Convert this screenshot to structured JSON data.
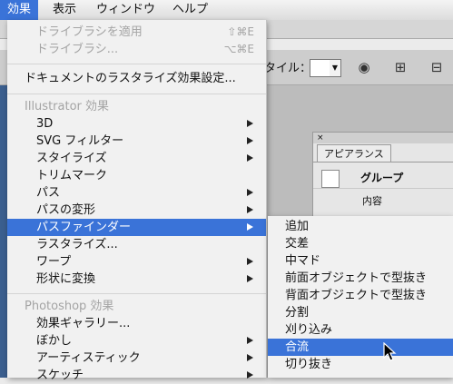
{
  "menubar": {
    "items": [
      {
        "label": "効果",
        "active": true
      },
      {
        "label": "表示",
        "active": false
      },
      {
        "label": "ウィンドウ",
        "active": false
      },
      {
        "label": "ヘルプ",
        "active": false
      }
    ]
  },
  "control_bar": {
    "style_label": "タイル：",
    "icons": [
      "recolor-icon",
      "align-grid-icon",
      "transform-icon"
    ]
  },
  "appearance_panel": {
    "close_glyph": "×",
    "tab": "アピアランス",
    "group_label": "グループ",
    "content_label": "内容"
  },
  "effect_menu": {
    "items": [
      {
        "label": "ドライブラシを適用",
        "shortcut": "⇧⌘E",
        "disabled": true
      },
      {
        "label": "ドライブラシ...",
        "shortcut": "⌥⌘E",
        "disabled": true
      },
      {
        "label": "ドキュメントのラスタライズ効果設定..."
      },
      {
        "label": "Illustrator 効果",
        "section": true
      },
      {
        "label": "3D",
        "submenu": true
      },
      {
        "label": "SVG フィルター",
        "submenu": true
      },
      {
        "label": "スタイライズ",
        "submenu": true
      },
      {
        "label": "トリムマーク"
      },
      {
        "label": "パス",
        "submenu": true
      },
      {
        "label": "パスの変形",
        "submenu": true
      },
      {
        "label": "パスファインダー",
        "submenu": true,
        "highlighted": true
      },
      {
        "label": "ラスタライズ..."
      },
      {
        "label": "ワープ",
        "submenu": true
      },
      {
        "label": "形状に変換",
        "submenu": true
      },
      {
        "label": "Photoshop 効果",
        "section": true
      },
      {
        "label": "効果ギャラリー..."
      },
      {
        "label": "ぼかし",
        "submenu": true
      },
      {
        "label": "アーティスティック",
        "submenu": true
      },
      {
        "label": "スケッチ",
        "submenu": true
      }
    ]
  },
  "pathfinder_submenu": {
    "items": [
      {
        "label": "追加"
      },
      {
        "label": "交差"
      },
      {
        "label": "中マド"
      },
      {
        "label": "前面オブジェクトで型抜き"
      },
      {
        "label": "背面オブジェクトで型抜き"
      },
      {
        "label": "分割"
      },
      {
        "label": "刈り込み"
      },
      {
        "label": "合流",
        "highlighted": true
      },
      {
        "label": "切り抜き"
      }
    ]
  },
  "colors": {
    "highlight": "#3a73d8",
    "menu_bg": "#f1f1f1",
    "disabled_text": "#a4a4a4"
  }
}
